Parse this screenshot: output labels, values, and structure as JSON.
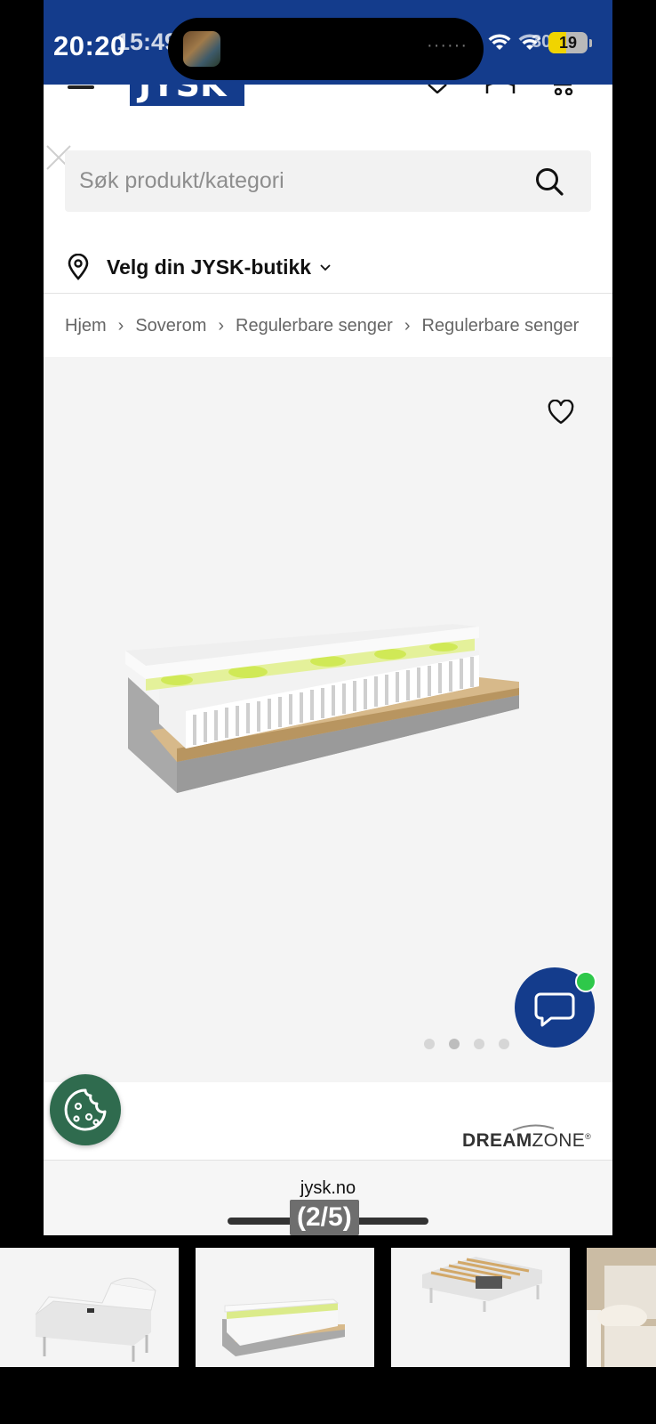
{
  "status_bar": {
    "time": "20:20",
    "time_ghost": "15:49",
    "battery_level": "19",
    "signal_ghost": "30",
    "island_dots": "······"
  },
  "search": {
    "placeholder": "Søk produkt/kategori"
  },
  "store": {
    "label": "Velg din JYSK-butikk"
  },
  "breadcrumb": [
    "Hjem",
    "Soverom",
    "Regulerbare senger",
    "Regulerbare senger"
  ],
  "brand": {
    "name_bold": "DREAM",
    "name_rest": "ZONE",
    "mark": "®"
  },
  "browser": {
    "url": "jysk.no",
    "image_counter": "(2/5)"
  },
  "logo": {
    "text": "JYSK"
  },
  "gallery": {
    "dot_count": 4,
    "active_dot": 1
  },
  "colors": {
    "brand_blue": "#143c8c",
    "cookie_green": "#2f6b4e",
    "online_green": "#2ec84a"
  },
  "icons": [
    "menu-icon",
    "heart-icon",
    "user-icon",
    "cart-icon",
    "close-icon",
    "search-icon",
    "location-pin-icon",
    "chevron-down-icon",
    "chevron-right-icon",
    "chat-icon",
    "cookie-icon"
  ]
}
